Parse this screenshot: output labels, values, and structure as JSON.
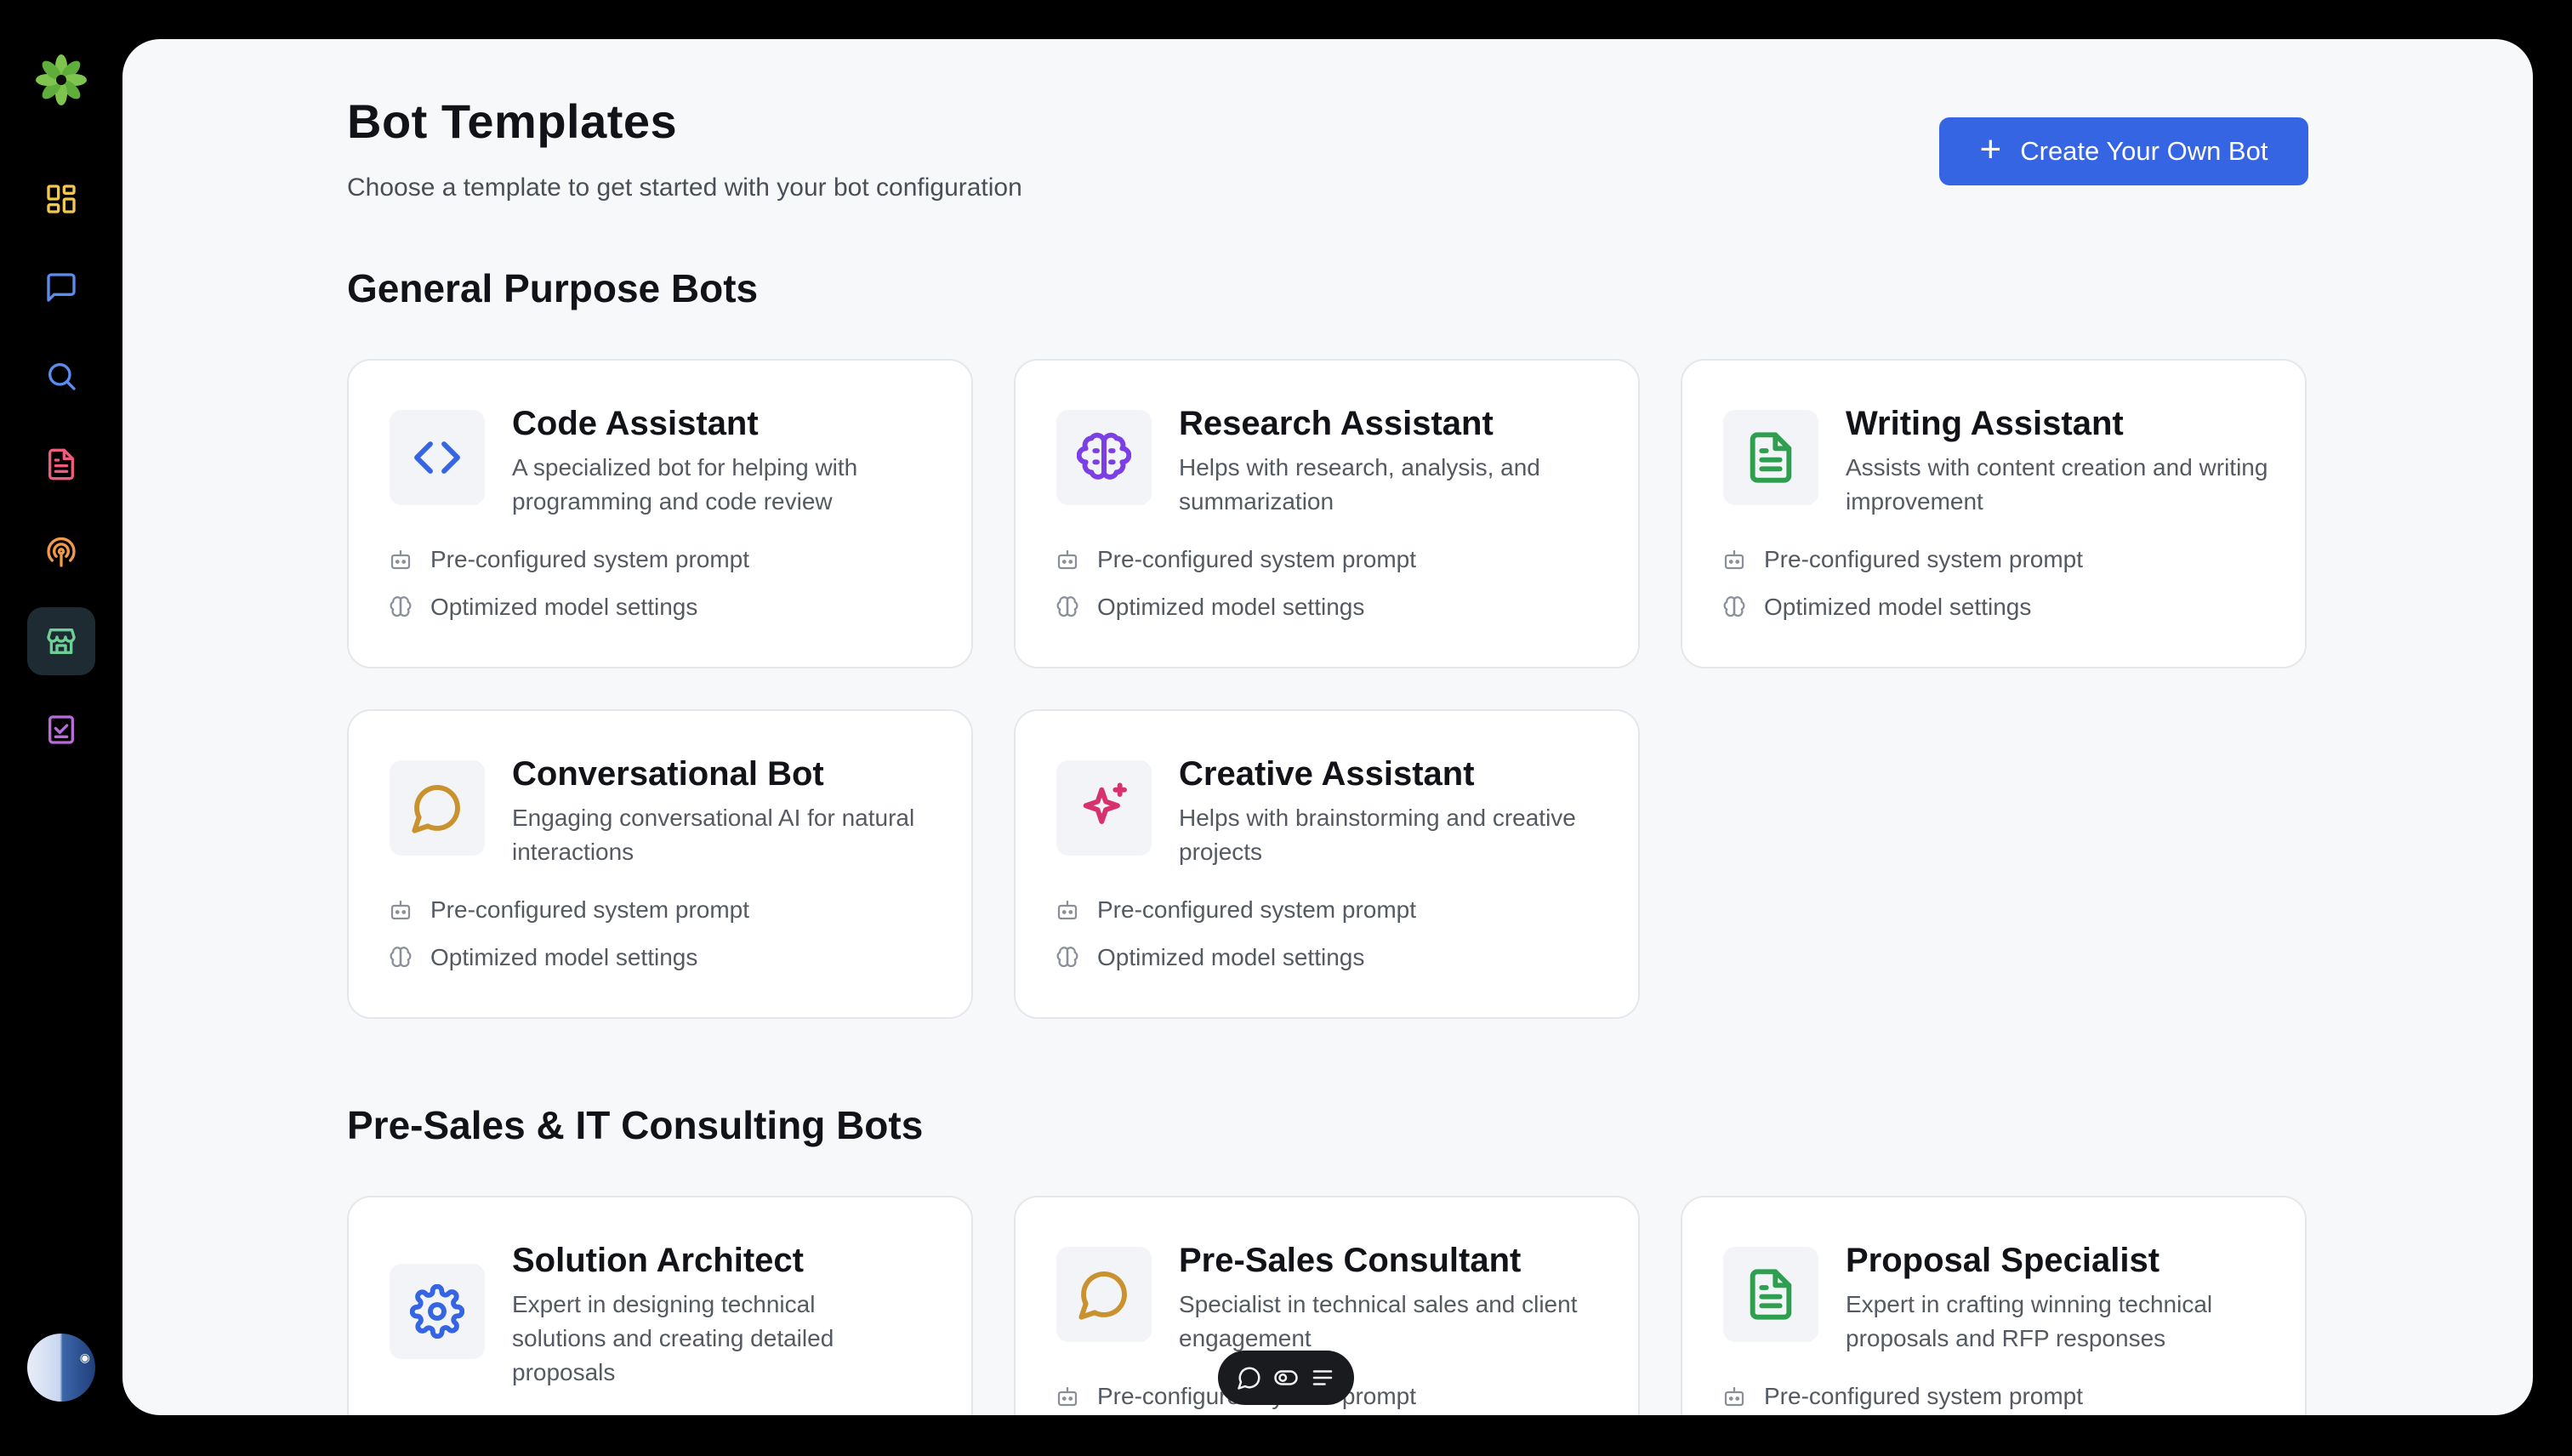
{
  "colors": {
    "accent": "#3565e3",
    "sidebar_bg": "#000000",
    "panel_bg": "#f7f8fa"
  },
  "sidebar": {
    "logo": "green-flower-logo",
    "items": [
      {
        "icon": "dashboard-icon",
        "color": "#f2c94c",
        "active": false
      },
      {
        "icon": "chat-icon",
        "color": "#5b8def",
        "active": false
      },
      {
        "icon": "search-icon",
        "color": "#5b8def",
        "active": false
      },
      {
        "icon": "document-icon",
        "color": "#ef5b7a",
        "active": false
      },
      {
        "icon": "podcast-icon",
        "color": "#f2994a",
        "active": false
      },
      {
        "icon": "store-icon",
        "color": "#6fcf97",
        "active": true
      },
      {
        "icon": "checklist-icon",
        "color": "#bb6bd9",
        "active": false
      }
    ],
    "avatar": "user-avatar"
  },
  "header": {
    "title": "Bot Templates",
    "subtitle": "Choose a template to get started with your bot configuration",
    "create_button": "Create Your Own Bot"
  },
  "sections": [
    {
      "title": "General Purpose Bots",
      "cards": [
        {
          "title": "Code Assistant",
          "description": "A specialized bot for helping with programming and code review",
          "icon": "code-icon",
          "icon_color": "#3565e3"
        },
        {
          "title": "Research Assistant",
          "description": "Helps with research, analysis, and summarization",
          "icon": "brain-icon",
          "icon_color": "#7b3fe4"
        },
        {
          "title": "Writing Assistant",
          "description": "Assists with content creation and writing improvement",
          "icon": "file-text-icon",
          "icon_color": "#2e9e4f"
        },
        {
          "title": "Conversational Bot",
          "description": "Engaging conversational AI for natural interactions",
          "icon": "message-circle-icon",
          "icon_color": "#c9922e"
        },
        {
          "title": "Creative Assistant",
          "description": "Helps with brainstorming and creative projects",
          "icon": "sparkles-icon",
          "icon_color": "#d6336c"
        }
      ]
    },
    {
      "title": "Pre-Sales & IT Consulting Bots",
      "cards": [
        {
          "title": "Solution Architect",
          "description": "Expert in designing technical solutions and creating detailed proposals",
          "icon": "settings-icon",
          "icon_color": "#3565e3"
        },
        {
          "title": "Pre-Sales Consultant",
          "description": "Specialist in technical sales and client engagement",
          "icon": "message-circle-icon",
          "icon_color": "#c9922e"
        },
        {
          "title": "Proposal Specialist",
          "description": "Expert in crafting winning technical proposals and RFP responses",
          "icon": "file-text-icon",
          "icon_color": "#2e9e4f"
        }
      ]
    }
  ],
  "features": {
    "system_prompt": "Pre-configured system prompt",
    "model_settings": "Optimized model settings"
  },
  "float_toolbar": {
    "icons": [
      "chat-bubble-icon",
      "toggle-icon",
      "list-icon"
    ]
  }
}
